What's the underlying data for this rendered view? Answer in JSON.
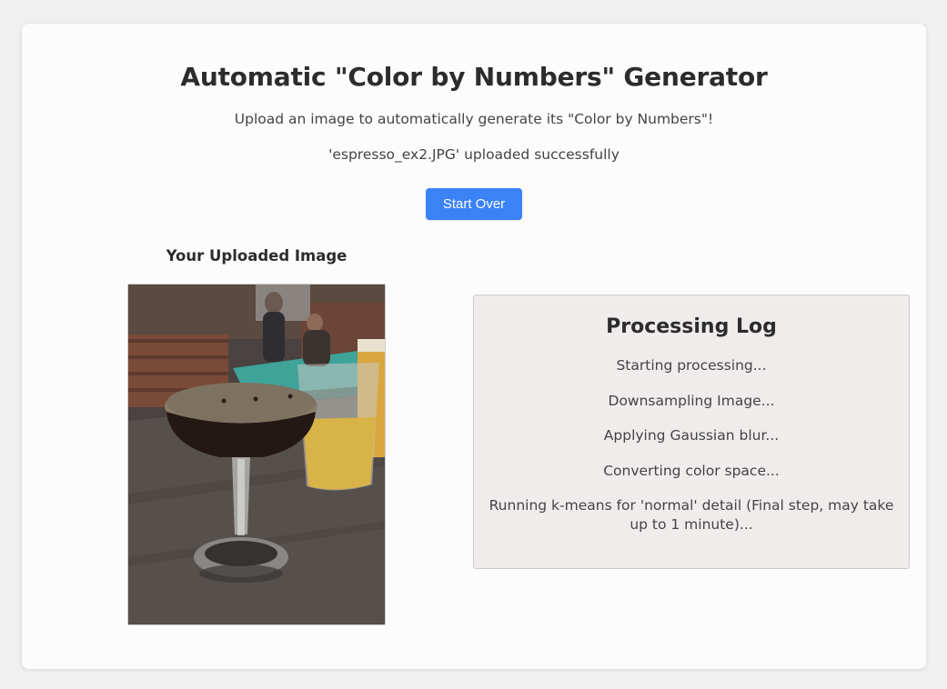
{
  "header": {
    "title": "Automatic \"Color by Numbers\" Generator",
    "subtitle": "Upload an image to automatically generate its \"Color by Numbers\"!",
    "status": "'espresso_ex2.JPG' uploaded successfully",
    "start_over_label": "Start Over"
  },
  "upload": {
    "heading": "Your Uploaded Image"
  },
  "log": {
    "title": "Processing Log",
    "entries": [
      "Starting processing...",
      "Downsampling Image...",
      "Applying Gaussian blur...",
      "Converting color space...",
      "Running k-means for 'normal' detail (Final step, may take up to 1 minute)..."
    ]
  },
  "colors": {
    "accent": "#3b82f6",
    "page_background": "#f1f0f1",
    "card_background": "#fdfcfd",
    "log_background": "#f0ecec"
  }
}
